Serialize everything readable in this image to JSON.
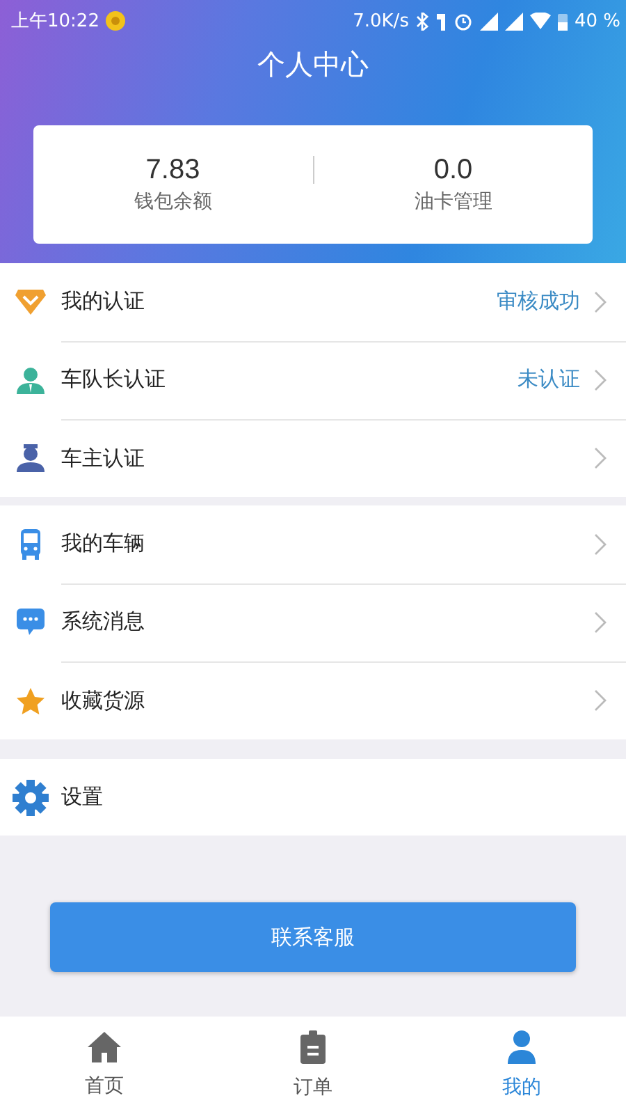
{
  "status_bar": {
    "time": "上午10:22",
    "speed": "7.0K/s",
    "battery": "40 %"
  },
  "header": {
    "title": "个人中心"
  },
  "summary": [
    {
      "value": "7.83",
      "label": "钱包余额"
    },
    {
      "value": "0.0",
      "label": "油卡管理"
    }
  ],
  "groups": [
    {
      "items": [
        {
          "label": "我的认证",
          "status": "审核成功"
        },
        {
          "label": "车队长认证",
          "status": "未认证"
        },
        {
          "label": "车主认证"
        }
      ]
    },
    {
      "items": [
        {
          "label": "我的车辆"
        },
        {
          "label": "系统消息"
        },
        {
          "label": "收藏货源"
        }
      ]
    }
  ],
  "settings": {
    "label": "设置"
  },
  "contact_button": "联系客服",
  "tab_bar": [
    {
      "label": "首页",
      "selected": false
    },
    {
      "label": "订单",
      "selected": false
    },
    {
      "label": "我的",
      "selected": true
    }
  ]
}
